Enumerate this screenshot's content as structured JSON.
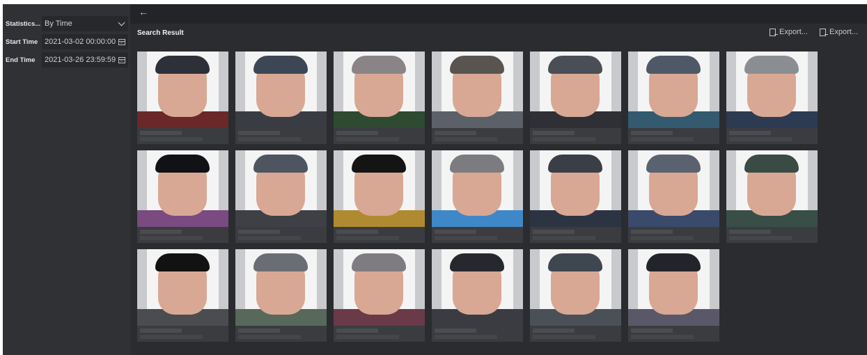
{
  "filters": {
    "statistics_label": "Statistics...",
    "statistics_value": "By Time",
    "start_label": "Start Time",
    "start_value": "2021-03-02 00:00:00",
    "end_label": "End Time",
    "end_value": "2021-03-26 23:59:59"
  },
  "header": {
    "back_icon": "back-arrow-icon",
    "title": "Search Result",
    "export_1": "Export...",
    "export_2": "Export..."
  },
  "results": {
    "rows": [
      [
        {
          "hair": "#2d3038",
          "shirt": "#6a2828"
        },
        {
          "hair": "#3d4654",
          "shirt": "#3a3c44"
        },
        {
          "hair": "#8a8486",
          "shirt": "#2e4a30"
        },
        {
          "hair": "#5a5450",
          "shirt": "#5c6068"
        },
        {
          "hair": "#4a4e56",
          "shirt": "#2e3036"
        },
        {
          "hair": "#4e5866",
          "shirt": "#335a6e"
        },
        {
          "hair": "#8a8e92",
          "shirt": "#2c3a52"
        }
      ],
      [
        {
          "hair": "#101216",
          "shirt": "#7a4a80"
        },
        {
          "hair": "#4e5460",
          "shirt": "#3e4046"
        },
        {
          "hair": "#141414",
          "shirt": "#b08a30"
        },
        {
          "hair": "#7c7c80",
          "shirt": "#3e88c8"
        },
        {
          "hair": "#3a3e46",
          "shirt": "#2c3444"
        },
        {
          "hair": "#5a6270",
          "shirt": "#3a4a6a"
        },
        {
          "hair": "#3a4a44",
          "shirt": "#3a4e48"
        }
      ],
      [
        {
          "hair": "#121212",
          "shirt": "#4a4c50"
        },
        {
          "hair": "#6a6e74",
          "shirt": "#58685a"
        },
        {
          "hair": "#7e7c80",
          "shirt": "#6a3a48"
        },
        {
          "hair": "#26282e",
          "shirt": "#3a3c42"
        },
        {
          "hair": "#3e4650",
          "shirt": "#4a5058"
        },
        {
          "hair": "#22242a",
          "shirt": "#5a5868"
        }
      ]
    ]
  }
}
